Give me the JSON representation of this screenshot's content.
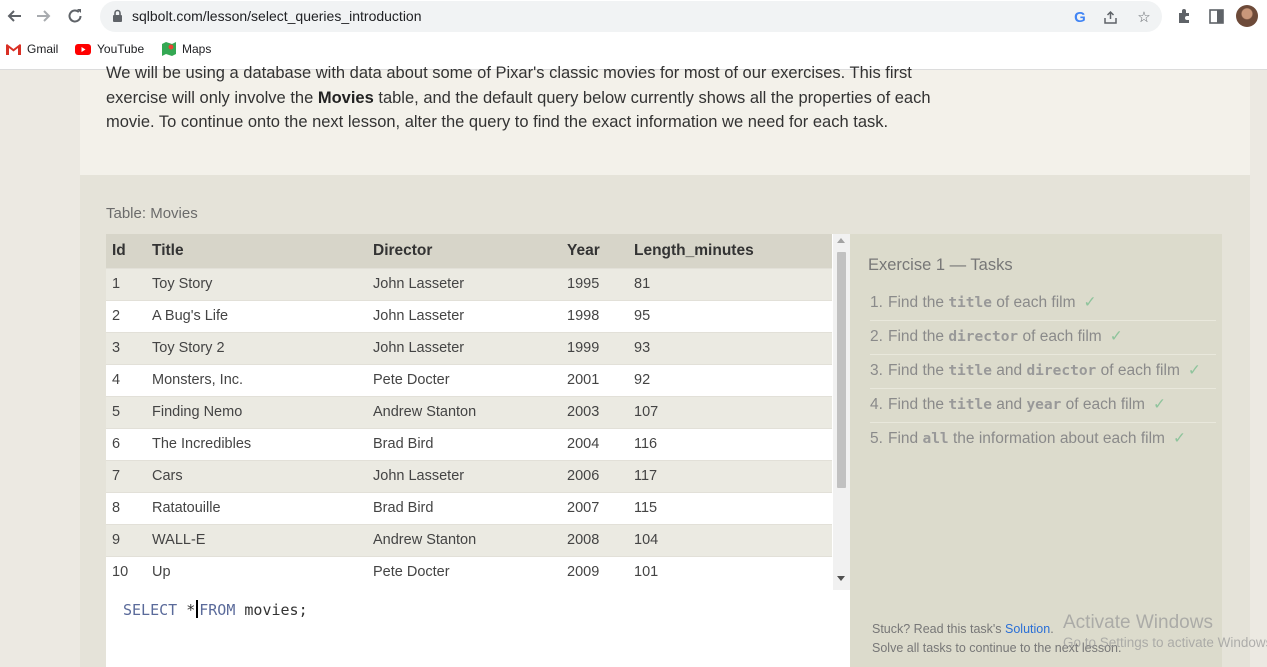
{
  "browser": {
    "url": "sqlbolt.com/lesson/select_queries_introduction",
    "bookmarks": [
      "Gmail",
      "YouTube",
      "Maps"
    ]
  },
  "intro": {
    "line1": "We will be using a database with data about some of Pixar's classic movies for most of our exercises. This first exercise will only involve the ",
    "bold": "Movies",
    "line2": " table, and the default query below currently shows all the properties of each movie. To continue onto the next lesson, alter the query to find the exact information we need for each task."
  },
  "table": {
    "caption": "Table: Movies",
    "columns": [
      "Id",
      "Title",
      "Director",
      "Year",
      "Length_minutes"
    ],
    "rows": [
      [
        "1",
        "Toy Story",
        "John Lasseter",
        "1995",
        "81"
      ],
      [
        "2",
        "A Bug's Life",
        "John Lasseter",
        "1998",
        "95"
      ],
      [
        "3",
        "Toy Story 2",
        "John Lasseter",
        "1999",
        "93"
      ],
      [
        "4",
        "Monsters, Inc.",
        "Pete Docter",
        "2001",
        "92"
      ],
      [
        "5",
        "Finding Nemo",
        "Andrew Stanton",
        "2003",
        "107"
      ],
      [
        "6",
        "The Incredibles",
        "Brad Bird",
        "2004",
        "116"
      ],
      [
        "7",
        "Cars",
        "John Lasseter",
        "2006",
        "117"
      ],
      [
        "8",
        "Ratatouille",
        "Brad Bird",
        "2007",
        "115"
      ],
      [
        "9",
        "WALL-E",
        "Andrew Stanton",
        "2008",
        "104"
      ],
      [
        "10",
        "Up",
        "Pete Docter",
        "2009",
        "101"
      ]
    ]
  },
  "editor": {
    "kw1": "SELECT",
    "star": "*",
    "kw2": "FROM",
    "rest": "movies;"
  },
  "tasks": {
    "title": "Exercise 1 — Tasks",
    "items": [
      {
        "num": "1.",
        "parts": [
          "Find the ",
          "title",
          " of each film"
        ]
      },
      {
        "num": "2.",
        "parts": [
          "Find the ",
          "director",
          " of each film"
        ]
      },
      {
        "num": "3.",
        "parts": [
          "Find the ",
          "title",
          " and ",
          "director",
          " of each film"
        ]
      },
      {
        "num": "4.",
        "parts": [
          "Find the ",
          "title",
          " and ",
          "year",
          " of each film"
        ]
      },
      {
        "num": "5.",
        "parts": [
          "Find ",
          "all",
          " the information about each film"
        ]
      }
    ],
    "check": "✓",
    "help_prefix": "Stuck? Read this task's ",
    "help_link": "Solution",
    "help_suffix": ".",
    "help_line2": "Solve all tasks to continue to the next lesson."
  },
  "watermark": {
    "line1": "Activate Windows",
    "line2": "Go to Settings to activate Windows."
  },
  "colors": {
    "header_bg": "#d7d5c9",
    "tasks_bg": "#dcdbcc",
    "check": "#8fc49c",
    "link": "#2a6fd6"
  }
}
